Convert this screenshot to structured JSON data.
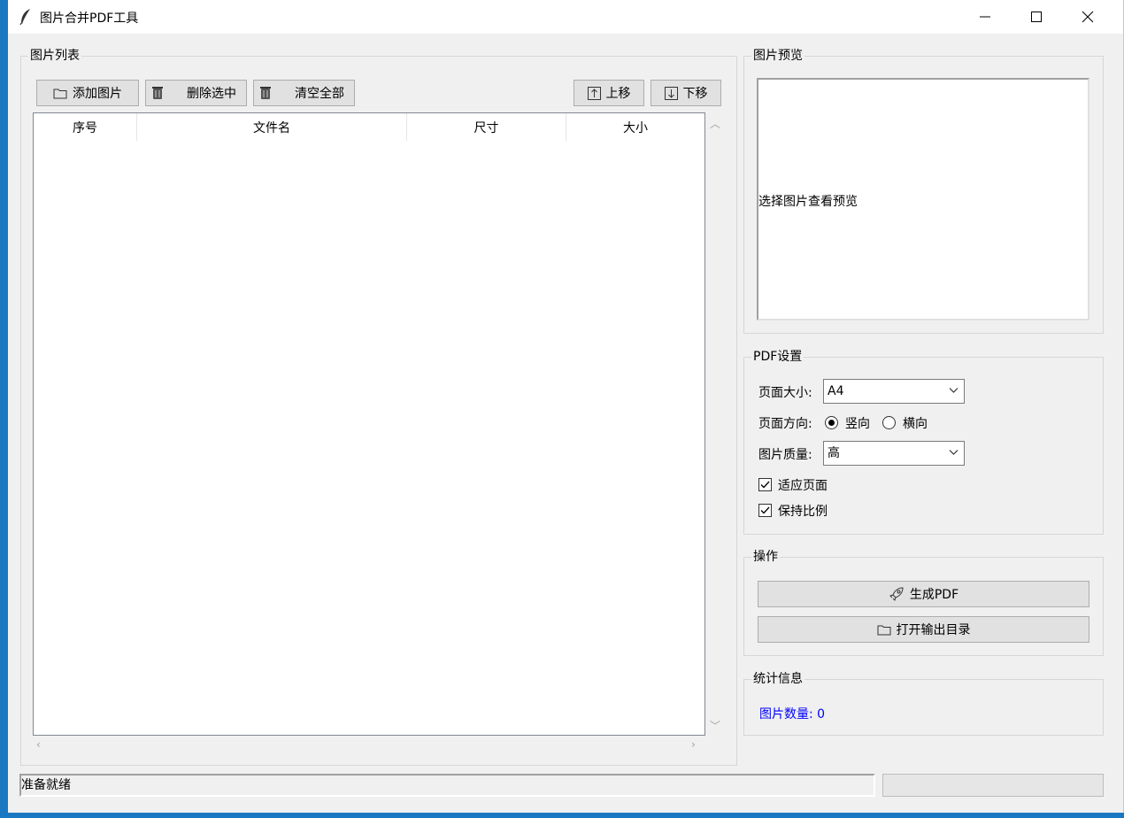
{
  "window": {
    "title": "图片合并PDF工具"
  },
  "image_list": {
    "group_label": "图片列表",
    "buttons": {
      "add": "添加图片",
      "delete": "删除选中",
      "clear": "清空全部",
      "up": "上移",
      "down": "下移"
    },
    "columns": [
      "序号",
      "文件名",
      "尺寸",
      "大小"
    ],
    "rows": []
  },
  "preview": {
    "group_label": "图片预览",
    "placeholder": "选择图片查看预览"
  },
  "pdf_settings": {
    "group_label": "PDF设置",
    "page_size_label": "页面大小:",
    "page_size_value": "A4",
    "orientation_label": "页面方向:",
    "orientation_portrait": "竖向",
    "orientation_landscape": "横向",
    "orientation_selected": "portrait",
    "quality_label": "图片质量:",
    "quality_value": "高",
    "fit_page_label": "适应页面",
    "fit_page_checked": true,
    "keep_ratio_label": "保持比例",
    "keep_ratio_checked": true
  },
  "actions": {
    "group_label": "操作",
    "generate": "生成PDF",
    "open_dir": "打开输出目录"
  },
  "stats": {
    "group_label": "统计信息",
    "count_text": "图片数量: 0"
  },
  "status": {
    "text": "准备就绪",
    "progress": 0
  },
  "colors": {
    "stats_text": "#0000ff",
    "progress_fill": "#06b025"
  }
}
